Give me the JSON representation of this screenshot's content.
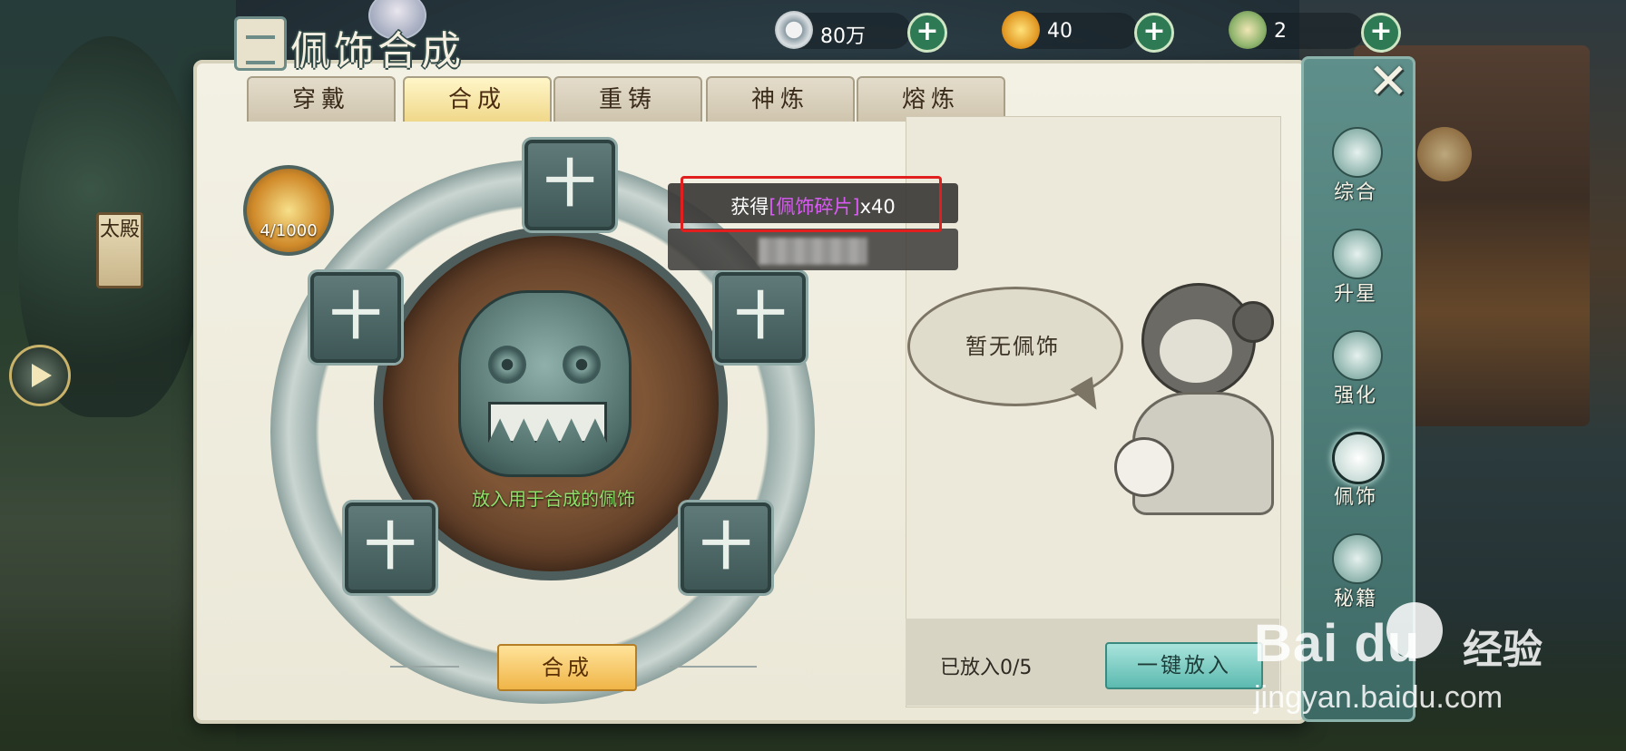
{
  "header": {
    "title": "佩饰合成",
    "resources": [
      {
        "name": "silver-coin",
        "value": "80万"
      },
      {
        "name": "gold-ingot",
        "value": "40"
      },
      {
        "name": "jade-token",
        "value": "2"
      }
    ]
  },
  "tabs": [
    "穿戴",
    "合成",
    "重铸",
    "神炼",
    "熔炼"
  ],
  "active_tab": "合成",
  "synthesis": {
    "fragment_count": "4/1000",
    "hint": "放入用于合成的佩饰",
    "compose_label": "合成",
    "slot_symbol": "十"
  },
  "toast": {
    "prefix": "获得",
    "item": "[佩饰碎片]",
    "suffix": "x40"
  },
  "right_panel": {
    "bubble_text": "暂无佩饰",
    "placed_label": "已放入0/5",
    "onekey_label": "一键放入"
  },
  "side_nav": [
    "综合",
    "升星",
    "强化",
    "佩饰",
    "秘籍"
  ],
  "side_nav_active": "佩饰",
  "close_symbol": "✕",
  "left_badge": "太殿",
  "watermark": {
    "logo": "Bai du",
    "brand": "经验",
    "url": "jingyan.baidu.com"
  },
  "colors": {
    "toast_item": "#d85cf2",
    "hint_green": "#8ee06a",
    "highlight_box": "#e21f1f",
    "compose_button": "#f0b548",
    "onekey_button": "#5cbab0"
  }
}
